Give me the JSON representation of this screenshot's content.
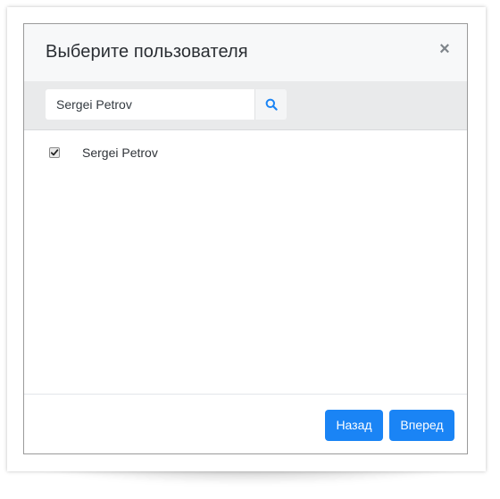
{
  "background": {
    "heading_fragment": ""
  },
  "modal": {
    "title": "Выберите пользователя",
    "close_symbol": "×",
    "search": {
      "value": "Sergei Petrov",
      "placeholder": "",
      "icon": "search-icon"
    },
    "results": [
      {
        "label": "Sergei Petrov",
        "checked": true
      }
    ],
    "footer": {
      "back_label": "Назад",
      "next_label": "Вперед"
    }
  },
  "colors": {
    "primary": "#1a84f5",
    "header_bg": "#f7f8f9",
    "search_bar_bg": "#e9eaeb"
  }
}
